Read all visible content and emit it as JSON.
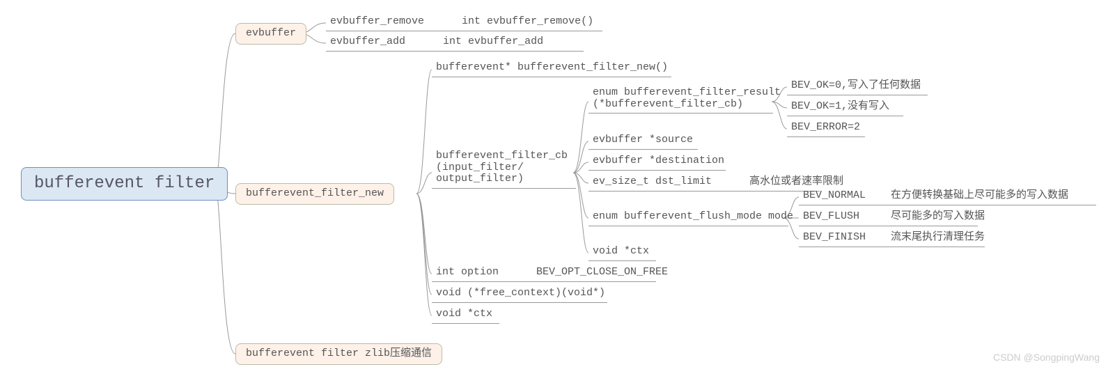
{
  "root": "bufferevent filter",
  "n_evbuffer": "evbuffer",
  "evbuffer_remove": "evbuffer_remove",
  "evbuffer_remove_sig": "int evbuffer_remove()",
  "evbuffer_add": "evbuffer_add",
  "evbuffer_add_sig": "int evbuffer_add",
  "n_filter_new": "bufferevent_filter_new",
  "filter_new_sig": "bufferevent* bufferevent_filter_new()",
  "cb_block": "bufferevent_filter_cb\n(input_filter/\noutput_filter)",
  "enum_result": "enum bufferevent_filter_result\n(*bufferevent_filter_cb)",
  "bev_ok0": "BEV_OK=0,写入了任何数据",
  "bev_ok1": "BEV_OK=1,没有写入",
  "bev_err": "BEV_ERROR=2",
  "src": "evbuffer *source",
  "dst": "evbuffer *destination",
  "dst_limit": "ev_size_t dst_limit",
  "dst_limit_note": "高水位或者速率限制",
  "flush_mode": "enum bufferevent_flush_mode mode",
  "bev_normal": "BEV_NORMAL",
  "bev_normal_note": "在方便转换基础上尽可能多的写入数据",
  "bev_flush": "BEV_FLUSH",
  "bev_flush_note": "尽可能多的写入数据",
  "bev_finish": "BEV_FINISH",
  "bev_finish_note": "流末尾执行清理任务",
  "void_ctx1": "void *ctx",
  "int_option": "int option",
  "int_option_note": "BEV_OPT_CLOSE_ON_FREE",
  "free_context": "void (*free_context)(void*)",
  "void_ctx2": "void *ctx",
  "n_zlib": "bufferevent filter zlib压缩通信",
  "watermark": "CSDN @SongpingWang"
}
